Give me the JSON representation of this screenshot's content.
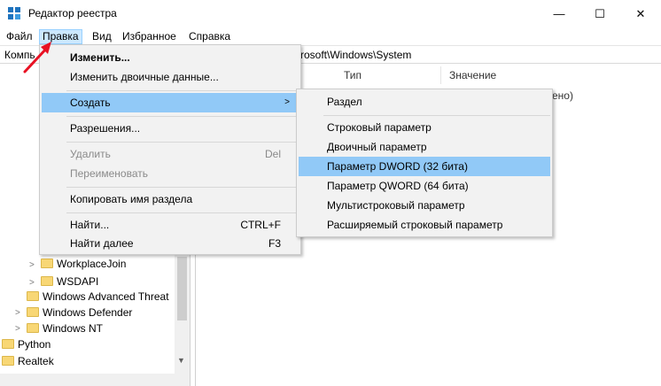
{
  "window": {
    "title": "Редактор реестра",
    "min_glyph": "—",
    "max_glyph": "☐",
    "close_glyph": "✕"
  },
  "menubar": {
    "file": "Файл",
    "edit": "Правка",
    "view": "Вид",
    "favorites": "Избранное",
    "help": "Справка"
  },
  "address": {
    "left": "Компь",
    "right": "rosoft\\Windows\\System"
  },
  "columns": {
    "type": "Тип",
    "value": "Значение",
    "partial_value": "ено)"
  },
  "tree": {
    "items": [
      {
        "label": "WorkplaceJoin"
      },
      {
        "label": "WSDAPI"
      },
      {
        "label": "Windows Advanced Threat"
      },
      {
        "label": "Windows Defender"
      },
      {
        "label": "Windows NT"
      },
      {
        "label": "Python"
      },
      {
        "label": "Realtek"
      }
    ]
  },
  "edit_menu": {
    "modify": "Изменить...",
    "modify_binary": "Изменить двоичные данные...",
    "create": "Создать",
    "permissions": "Разрешения...",
    "delete": "Удалить",
    "delete_shortcut": "Del",
    "rename": "Переименовать",
    "copy_key_name": "Копировать имя раздела",
    "find": "Найти...",
    "find_shortcut": "CTRL+F",
    "find_next": "Найти далее",
    "find_next_shortcut": "F3"
  },
  "create_submenu": {
    "items": [
      {
        "label": "Раздел"
      },
      {
        "label": "Строковый параметр"
      },
      {
        "label": "Двоичный параметр"
      },
      {
        "label": "Параметр DWORD (32 бита)"
      },
      {
        "label": "Параметр QWORD (64 бита)"
      },
      {
        "label": "Мультистроковый параметр"
      },
      {
        "label": "Расширяемый строковый параметр"
      }
    ],
    "highlighted_index": 3
  },
  "colors": {
    "highlight": "#91c9f7",
    "menu_active": "#cce8ff",
    "folder": "#f8d775",
    "arrow": "#e81123"
  }
}
